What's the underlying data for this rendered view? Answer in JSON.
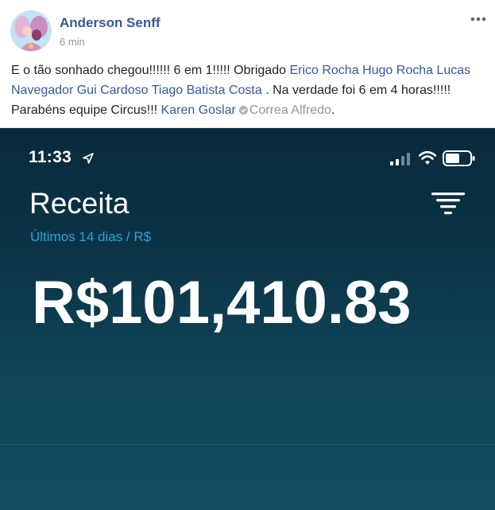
{
  "post": {
    "author": "Anderson Senff",
    "time": "6 min",
    "text": {
      "intro": "E o tão sonhado chegou!!!!!! 6 em 1!!!!! Obrigado ",
      "tag_erico": "Erico Rocha",
      "tag_hugo": "Hugo Rocha",
      "tag_lucas": "Lucas Navegador",
      "tag_gui": "Gui Cardoso",
      "tag_tiago": "Tiago Batista Costa",
      "middle": " . Na verdade foi 6 em 4 horas!!!!! Parabéns equipe Circus!!! ",
      "tag_karen": "Karen Goslar",
      "tag_correa": "Correa Alfredo",
      "end": "."
    }
  },
  "screenshot": {
    "status_time": "11:33",
    "title": "Receita",
    "period": "Últimos 14 dias / R$",
    "amount": "R$101,410.83"
  },
  "icons": {
    "more": "more-options-icon",
    "location": "location-arrow-icon",
    "signal": "signal-icon",
    "wifi": "wifi-icon",
    "battery": "battery-icon",
    "filter": "filter-icon",
    "verified": "verified-check-icon"
  },
  "colors": {
    "link": "#385898",
    "text": "#1d2129",
    "muted": "#90949c",
    "app_bg": "#0b3346",
    "app_accent": "#21a6dc"
  }
}
